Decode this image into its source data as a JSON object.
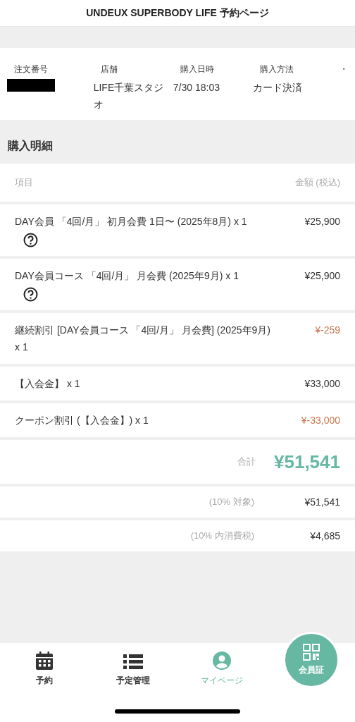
{
  "header": {
    "title": "UNDEUX SUPERBODY LIFE 予約ページ"
  },
  "order_info": {
    "columns": [
      {
        "label": "注文番号",
        "kind": "redacted"
      },
      {
        "label": "店舗",
        "value": "LIFE千葉スタジオ",
        "kind": "text"
      },
      {
        "label": "購入日時",
        "value": "7/30 18:03",
        "kind": "text"
      },
      {
        "label": "購入方法",
        "value": "カード決済",
        "kind": "text"
      },
      {
        "label": "・",
        "kind": "empty"
      }
    ]
  },
  "details": {
    "heading": "購入明細",
    "columns": [
      "項目",
      "金額 (税込)"
    ],
    "rows": [
      {
        "item": "DAY会員 「4回/月」 初月会費 1日〜 (2025年8月) x 1",
        "amount": "¥25,900",
        "kind": "charge",
        "help": true
      },
      {
        "item": "DAY会員コース 「4回/月」 月会費 (2025年9月) x 1",
        "amount": "¥25,900",
        "kind": "charge",
        "help": true
      },
      {
        "item": "継続割引 [DAY会員コース 「4回/月」 月会費] (2025年9月) x 1",
        "amount": "¥-259",
        "kind": "discount",
        "help": false
      },
      {
        "item": "【入会金】 x 1",
        "amount": "¥33,000",
        "kind": "charge",
        "help": false
      },
      {
        "item": "クーポン割引 (【入会金】) x 1",
        "amount": "¥-33,000",
        "kind": "discount",
        "help": false
      }
    ],
    "total": {
      "label": "合計",
      "amount": "¥51,541"
    },
    "tax_rows": [
      {
        "label": "(10% 対象)",
        "amount": "¥51,541"
      },
      {
        "label": "(10% 内消費税)",
        "amount": "¥4,685"
      }
    ]
  },
  "bottom_nav": {
    "items": [
      {
        "label": "予約",
        "kind": "calendar",
        "selected": false
      },
      {
        "label": "予定管理",
        "kind": "list",
        "selected": false
      },
      {
        "label": "マイページ",
        "kind": "user",
        "selected": true
      }
    ],
    "member_card": {
      "label": "会員証"
    }
  }
}
